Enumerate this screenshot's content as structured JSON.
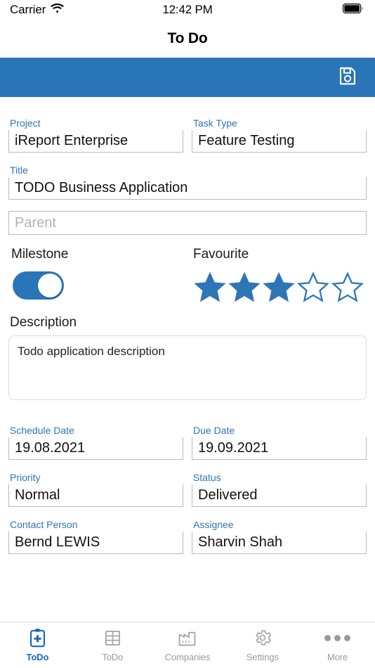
{
  "status_bar": {
    "carrier": "Carrier",
    "wifi_icon": "wifi-icon",
    "time": "12:42 PM",
    "battery_icon": "battery-full-icon"
  },
  "navbar": {
    "title": "To Do"
  },
  "toolbar": {
    "background_color": "#2a74b8",
    "save_icon": "floppy-disk-save-icon"
  },
  "form": {
    "project": {
      "label": "Project",
      "value": "iReport Enterprise"
    },
    "task_type": {
      "label": "Task Type",
      "value": "Feature Testing"
    },
    "title": {
      "label": "Title",
      "value": "TODO Business Application"
    },
    "parent": {
      "label": "Parent",
      "value": "",
      "placeholder": "Parent"
    },
    "milestone": {
      "label": "Milestone",
      "state": "on"
    },
    "favourite": {
      "label": "Favourite",
      "rating": 3,
      "max": 5
    },
    "description": {
      "label": "Description",
      "value": "Todo application description"
    },
    "schedule_date": {
      "label": "Schedule Date",
      "value": "19.08.2021"
    },
    "due_date": {
      "label": "Due Date",
      "value": "19.09.2021"
    },
    "priority": {
      "label": "Priority",
      "value": "Normal"
    },
    "status": {
      "label": "Status",
      "value": "Delivered"
    },
    "contact_person": {
      "label": "Contact Person",
      "value": "Bernd LEWIS"
    },
    "assignee": {
      "label": "Assignee",
      "value": "Sharvin Shah"
    }
  },
  "tabbar": {
    "active_color": "#1565c0",
    "inactive_color": "#9a9a9a",
    "items": [
      {
        "label": "ToDo",
        "icon": "clipboard-plus-icon",
        "active": true
      },
      {
        "label": "ToDo",
        "icon": "table-grid-icon",
        "active": false
      },
      {
        "label": "Companies",
        "icon": "factory-icon",
        "active": false
      },
      {
        "label": "Settings",
        "icon": "gear-icon",
        "active": false
      },
      {
        "label": "More",
        "icon": "ellipsis-icon",
        "active": false
      }
    ]
  }
}
